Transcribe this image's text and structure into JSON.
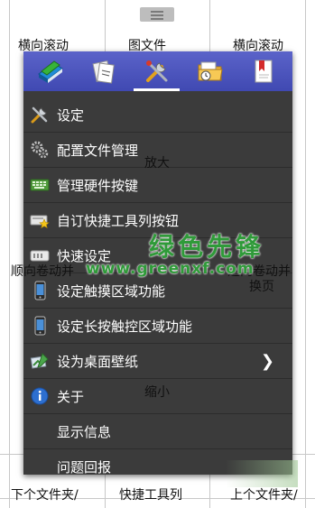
{
  "background": {
    "labels": {
      "top_left": "横向滚动",
      "top_mid": "图文件",
      "top_right": "横向滚动",
      "zoom_in": "放大",
      "left_scroll": "顺向卷动并",
      "right_scroll": "逆向卷动并",
      "page_turn": "换页",
      "zoom_out": "缩小",
      "bottom_left": "下个文件夹/",
      "bottom_mid": "快捷工具列",
      "bottom_right": "上个文件夹/"
    }
  },
  "tabs": [
    {
      "icon": "books-icon"
    },
    {
      "icon": "documents-icon"
    },
    {
      "icon": "tools-icon",
      "active": true
    },
    {
      "icon": "folder-icon"
    },
    {
      "icon": "bookmark-icon"
    }
  ],
  "menu": {
    "items": [
      {
        "label": "设定",
        "icon": "tools-icon"
      },
      {
        "label": "配置文件管理",
        "icon": "gears-icon"
      },
      {
        "label": "管理硬件按键",
        "icon": "keyboard-icon"
      },
      {
        "label": "自订快捷工具列按钮",
        "icon": "toolbar-star-icon"
      },
      {
        "label": "快速设定",
        "icon": "toggle-icon"
      },
      {
        "label": "设定触摸区域功能",
        "icon": "phone-icon"
      },
      {
        "label": "设定长按触控区域功能",
        "icon": "phone-icon"
      },
      {
        "label": "设为桌面壁纸",
        "icon": "wallpaper-icon",
        "has_submenu": true
      },
      {
        "label": "关于",
        "icon": "info-icon"
      },
      {
        "label": "显示信息",
        "icon": ""
      },
      {
        "label": "问题回报",
        "icon": ""
      }
    ]
  },
  "watermark": {
    "title": "绿色先锋",
    "url": "www.greenxf.com"
  }
}
